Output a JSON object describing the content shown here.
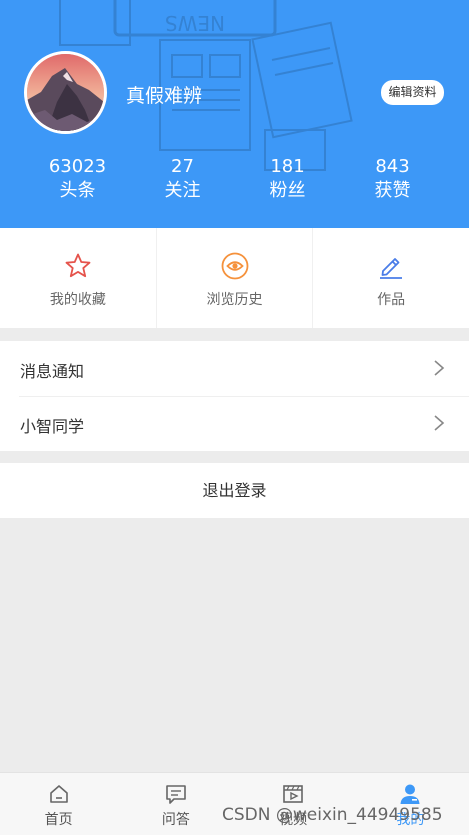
{
  "profile": {
    "username": "真假难辨",
    "edit_label": "编辑资料",
    "background_text": "NEWS"
  },
  "stats": [
    {
      "value": "63023",
      "label": "头条"
    },
    {
      "value": "27",
      "label": "关注"
    },
    {
      "value": "181",
      "label": "粉丝"
    },
    {
      "value": "843",
      "label": "获赞"
    }
  ],
  "actions": [
    {
      "label": "我的收藏",
      "icon": "star-icon",
      "color": "#e5534b"
    },
    {
      "label": "浏览历史",
      "icon": "eye-icon",
      "color": "#f5913b"
    },
    {
      "label": "作品",
      "icon": "pencil-icon",
      "color": "#4a7de8"
    }
  ],
  "menu": [
    {
      "label": "消息通知"
    },
    {
      "label": "小智同学"
    }
  ],
  "logout_label": "退出登录",
  "tabs": [
    {
      "label": "首页",
      "icon": "home-icon"
    },
    {
      "label": "问答",
      "icon": "chat-icon"
    },
    {
      "label": "视频",
      "icon": "video-icon"
    },
    {
      "label": "我的",
      "icon": "user-icon",
      "active": true
    }
  ],
  "watermark": "CSDN @weixin_44949585",
  "colors": {
    "primary": "#3d98f7",
    "background": "#ececec"
  }
}
